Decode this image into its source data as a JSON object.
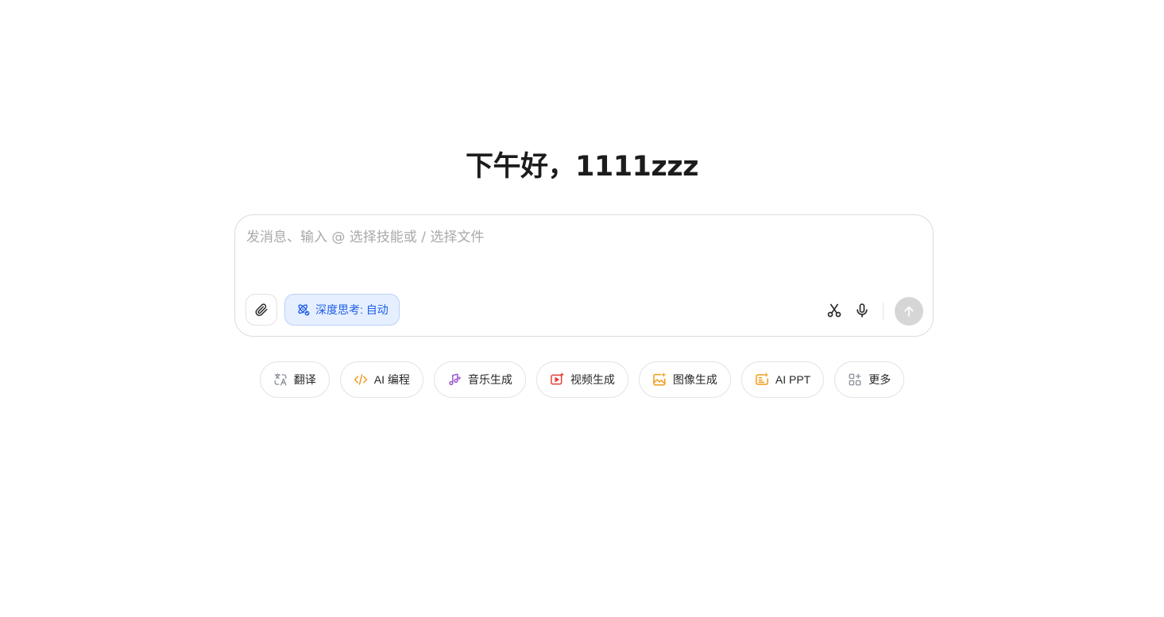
{
  "greeting": "下午好，1111zzz",
  "composer": {
    "placeholder": "发消息、输入 @ 选择技能或 / 选择文件",
    "value": "",
    "deep_think_label": "深度思考: 自动"
  },
  "icons": {
    "attach": "paperclip-icon",
    "deep_think": "atom-icon",
    "screenshot": "scissors-icon",
    "voice": "microphone-icon",
    "send": "arrow-up-icon"
  },
  "skills": [
    {
      "label": "翻译",
      "icon": "translate-icon",
      "color": "#8a8f99"
    },
    {
      "label": "AI 编程",
      "icon": "code-icon",
      "color": "#f29a1b"
    },
    {
      "label": "音乐生成",
      "icon": "music-note-icon",
      "color": "#9b59d0"
    },
    {
      "label": "视频生成",
      "icon": "video-play-icon",
      "color": "#e5403a"
    },
    {
      "label": "图像生成",
      "icon": "image-icon",
      "color": "#f29a1b"
    },
    {
      "label": "AI PPT",
      "icon": "presentation-icon",
      "color": "#f29a1b"
    },
    {
      "label": "更多",
      "icon": "grid-plus-icon",
      "color": "#8a8f99"
    }
  ],
  "colors": {
    "accent": "#1e5ee8",
    "accent_bg": "#e6efff",
    "send_disabled": "#d6d6d6"
  }
}
